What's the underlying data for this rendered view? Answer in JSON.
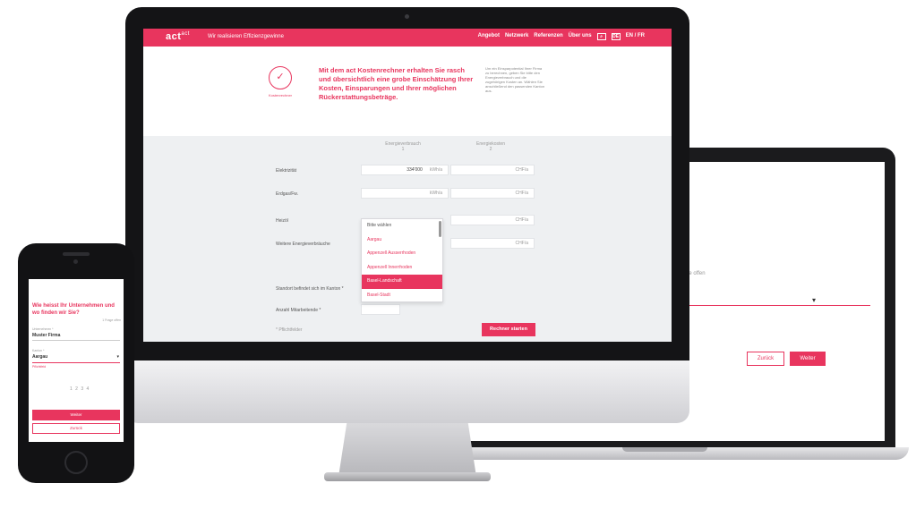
{
  "brand": {
    "accent": "#e8355e",
    "dark": "#141416"
  },
  "desktop": {
    "logo": "act",
    "logo_suffix": "act",
    "tagline": "Wir realisieren Effizienzgewinne",
    "nav_links": [
      "Angebot",
      "Netzwerk",
      "Referenzen",
      "Über uns"
    ],
    "nav_icons": [
      "search-icon",
      "login-icon",
      "language-switch"
    ],
    "nav_icon_label": "DE",
    "nav_lang": "EN / FR",
    "intro": {
      "icon_label": "Kostenrechner",
      "text": "Mit dem act Kostenrechner erhalten Sie rasch und übersichtlich eine grobe Einschätzung Ihrer Kosten, Einsparungen und Ihrer möglichen Rückerstattungsbeträge.",
      "side_note": "Um ein Einsparpotential Ihrer Firma zu berechnen, geben Sie bitte den Energieverbrauch und die zugehörigen Kosten an. Wählen Sie anschließend den passenden Kanton aus."
    },
    "calculator": {
      "col_headers": [
        "Energieverbrauch",
        "Energiekosten"
      ],
      "col_subheaders": [
        "1",
        "2"
      ],
      "rows": [
        {
          "label": "Elektrizität",
          "value": "334'000",
          "unit": "kWh/a",
          "unit2": "CHF/a"
        },
        {
          "label": "Erdgas/Fw.",
          "value": "",
          "unit": "kWh/a",
          "unit2": "CHF/a"
        },
        {
          "label": "Heizöl",
          "value": "",
          "unit": "",
          "unit2": "CHF/a"
        },
        {
          "label": "Weitere Energieverbräuche",
          "value": "",
          "unit": "",
          "unit2": "CHF/a"
        }
      ],
      "dropdown": {
        "options": [
          "Bitte wählen",
          "Aargau",
          "Appenzell Ausserrhoden",
          "Appenzell Innerrhoden",
          "Basel-Landschaft",
          "Basel-Stadt"
        ],
        "selected": "Basel-Landschaft"
      },
      "canton_label": "Standort befindet sich im Kanton *",
      "employees_label": "Anzahl Mitarbeitende *",
      "mandatory_note": "* Pflichtfelder",
      "start_button": "Rechner starten"
    }
  },
  "laptop": {
    "progress": "1 Frage offen",
    "back_button": "Zurück",
    "next_button": "Weiter"
  },
  "phone": {
    "question": "Wie heisst Ihr Unternehmen und wo finden wir Sie?",
    "progress": "1 Frage offen",
    "company_label": "Unternehmen *",
    "company_value": "Muster Firma",
    "canton_label": "Kanton *",
    "canton_value": "Aargau",
    "error_text": "Pflichtfeld",
    "pagination": "1 2 3 4",
    "next_button": "Weiter",
    "back_button": "Zurück"
  }
}
